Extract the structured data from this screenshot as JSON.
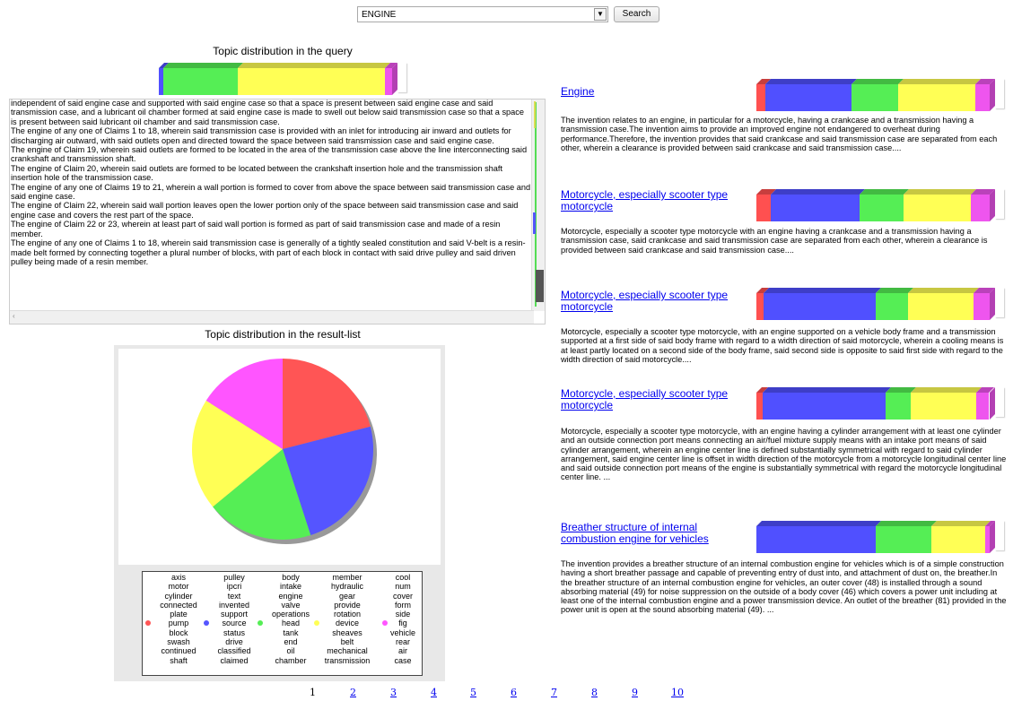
{
  "search": {
    "selected": "ENGINE",
    "button_label": "Search"
  },
  "query_panel": {
    "heading": "Topic distribution in the query",
    "bar": [
      {
        "color": "#5050ff",
        "pct": 2
      },
      {
        "color": "#55ee55",
        "pct": 32
      },
      {
        "color": "#ffff55",
        "pct": 63
      },
      {
        "color": "#ee55ee",
        "pct": 3
      }
    ],
    "text": [
      "independent of said engine case and supported with said engine case so that a space is present between said engine case and said transmission case, and a lubricant oil chamber formed at said engine case is made to swell out below said transmission case so that a space is present between said lubricant oil chamber and said transmission case.",
      "The engine of any one of Claims 1 to 18, wherein said transmission case is provided with an inlet for introducing air inward and outlets for discharging air outward, with said outlets open and directed toward the space between said transmission case and said engine case.",
      "The engine of Claim 19, wherein said outlets are formed to be located in the area of the transmission case above the line interconnecting said crankshaft and transmission shaft.",
      "The engine of Claim 20, wherein said outlets are formed to be located between the crankshaft insertion hole and the transmission shaft insertion hole of the transmission case.",
      "The engine of any one of Claims 19 to 21, wherein a wall portion is formed to cover from above the space between said transmission case and said engine case.",
      "The engine of Claim 22, wherein said wall portion leaves open the lower portion only of the space between said transmission case and said engine case and covers the rest part of the space.",
      "The engine of Claim 22 or 23, wherein at least part of said wall portion is formed as part of said transmission case and made of a resin member.",
      "The engine of any one of Claims 1 to 18, wherein said transmission case is generally of a tightly sealed constitution and said V-belt is a resin-made belt formed by connecting together a plural number of blocks, with part of each block in contact with said drive pulley and said driven pulley being made of a resin member."
    ]
  },
  "result_panel": {
    "heading": "Topic distribution in the result-list",
    "legend": [
      {
        "color": "#ff5555",
        "words": [
          "axis",
          "motor",
          "cylinder",
          "connected",
          "plate",
          "pump",
          "block",
          "swash",
          "continued",
          "shaft"
        ]
      },
      {
        "color": "#5555ff",
        "words": [
          "pulley",
          "ipcri",
          "text",
          "invented",
          "support",
          "source",
          "status",
          "drive",
          "classified",
          "claimed"
        ]
      },
      {
        "color": "#55ee55",
        "words": [
          "body",
          "intake",
          "engine",
          "valve",
          "operations",
          "head",
          "tank",
          "end",
          "oil",
          "chamber"
        ]
      },
      {
        "color": "#ffff55",
        "words": [
          "member",
          "hydraulic",
          "gear",
          "provide",
          "rotation",
          "device",
          "sheaves",
          "belt",
          "mechanical",
          "transmission"
        ]
      },
      {
        "color": "#ff55ff",
        "words": [
          "cool",
          "num",
          "cover",
          "form",
          "side",
          "fig",
          "vehicle",
          "rear",
          "air",
          "case"
        ]
      }
    ]
  },
  "chart_data": {
    "type": "pie",
    "values": [
      21,
      24,
      19,
      20,
      16
    ],
    "colors": [
      "#ff5555",
      "#5555ff",
      "#55ee55",
      "#ffff55",
      "#ff55ff"
    ]
  },
  "results": [
    {
      "title": "Engine",
      "bar": [
        {
          "color": "#ff5050",
          "pct": 4
        },
        {
          "color": "#5050ff",
          "pct": 37
        },
        {
          "color": "#55ee55",
          "pct": 20
        },
        {
          "color": "#ffff55",
          "pct": 33
        },
        {
          "color": "#ee55ee",
          "pct": 6
        }
      ],
      "desc": "The invention relates to an engine, in particular for a motorcycle, having a crankcase and a transmission having a transmission case.The invention aims to provide an improved engine not endangered to overheat during performance.Therefore, the invention provides that said crankcase and said transmission case are separated from each other, wherein a clearance is provided between said crankcase and said transmission case...."
    },
    {
      "title": "Motorcycle, especially scooter type motorcycle",
      "bar": [
        {
          "color": "#ff5050",
          "pct": 6
        },
        {
          "color": "#5050ff",
          "pct": 38
        },
        {
          "color": "#55ee55",
          "pct": 19
        },
        {
          "color": "#ffff55",
          "pct": 29
        },
        {
          "color": "#ee55ee",
          "pct": 8
        }
      ],
      "desc": "Motorcycle, especially a scooter type motorcycle with an engine having a crankcase and a transmission having a transmission case, said crankcase and said transmission case are separated from each other, wherein a clearance is provided between said crankcase and said transmission case...."
    },
    {
      "title": "Motorcycle, especially scooter type motorcycle",
      "bar": [
        {
          "color": "#ff5050",
          "pct": 3
        },
        {
          "color": "#5050ff",
          "pct": 48
        },
        {
          "color": "#55ee55",
          "pct": 14
        },
        {
          "color": "#ffff55",
          "pct": 28
        },
        {
          "color": "#ee55ee",
          "pct": 7
        }
      ],
      "desc": "Motorcycle, especially a scooter type motorcycle, with an engine supported on a vehicle body frame and a transmission supported at a first side of said body frame with regard to a width direction of said motorcycle, wherein a cooling means is at least partly located on a second side of the body frame, said second side is opposite to said first side with regard to the width direction of said motorcycle...."
    },
    {
      "title": "Motorcycle, especially scooter type motorcycle",
      "bar": [
        {
          "color": "#ff5050",
          "pct": 3
        },
        {
          "color": "#5050ff",
          "pct": 58
        },
        {
          "color": "#55ee55",
          "pct": 12
        },
        {
          "color": "#ffff55",
          "pct": 31
        },
        {
          "color": "#ee55ee",
          "pct": 6
        }
      ],
      "desc": "Motorcycle, especially a scooter type motorcycle, with an engine having a cylinder arrangement with at least one cylinder and an outside connection port means connecting an air/fuel mixture supply means with an intake port means of said cylinder arrangement, wherein an engine center line is defined substantially symmetrical with regard to said cylinder arrangement, said engine center line is offset in width direction of the motorcycle from a motorcycle longitudinal center line and said outside connection port means of the engine is substantially symmetrical with regard the motorcycle longitudinal center line. ..."
    },
    {
      "title": "Breather structure of internal combustion engine for vehicles",
      "bar": [
        {
          "color": "#ff5050",
          "pct": 0
        },
        {
          "color": "#5050ff",
          "pct": 51
        },
        {
          "color": "#55ee55",
          "pct": 24
        },
        {
          "color": "#ffff55",
          "pct": 23
        },
        {
          "color": "#ee55ee",
          "pct": 2
        }
      ],
      "desc": "The invention provides a breather structure of an internal combustion engine for vehicles which is of a simple construction having a short breather passage and capable of preventing entry of dust into, and attachment of dust on, the breather.In the breather structure of an internal combustion engine for vehicles, an outer cover (48) is installed through a sound absorbing material (49) for noise suppression on the outside of a body cover (46) which covers a power unit including at least one of the internal combustion engine and a power transmission device. An outlet of the breather (81) provided in the power unit is open at the sound absorbing material (49). ..."
    }
  ],
  "pagination": {
    "current": "1",
    "pages": [
      "2",
      "3",
      "4",
      "5",
      "6",
      "7",
      "8",
      "9",
      "10"
    ]
  }
}
